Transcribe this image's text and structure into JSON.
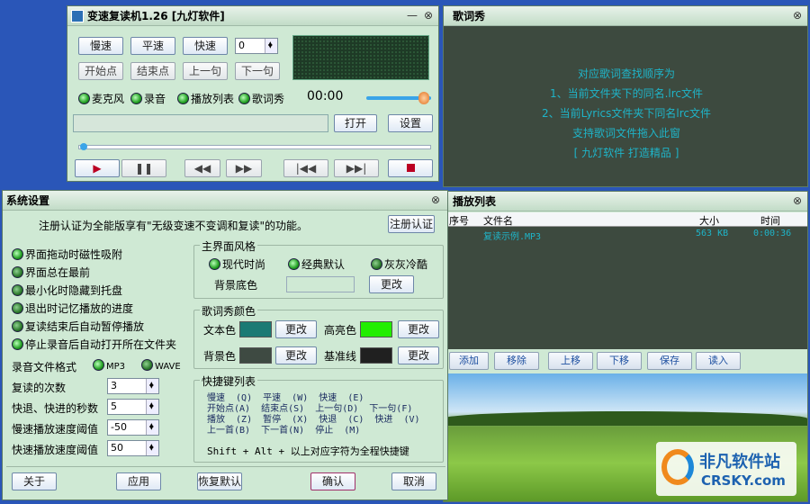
{
  "player": {
    "title": "变速复读机1.26 [九灯软件]",
    "close": "⊗",
    "buttons": [
      "慢速",
      "平速",
      "快速"
    ],
    "speed_value": "0",
    "buttons2": [
      "开始点",
      "结束点",
      "上一句",
      "下一句"
    ],
    "toggles": [
      "麦克风",
      "录音",
      "播放列表",
      "歌词秀"
    ],
    "time": "00:00",
    "open": "打开",
    "settings": "设置"
  },
  "lyric": {
    "title": "歌词秀",
    "close": "⊗",
    "lines": [
      "对应歌词查找顺序为",
      "1、当前文件夹下的同名.lrc文件",
      "2、当前Lyrics文件夹下同名lrc文件",
      "支持歌词文件拖入此窗",
      "[ 九灯软件 打造精品 ]"
    ]
  },
  "settings": {
    "title": "系统设置",
    "close": "⊗",
    "notice": "注册认证为全能版享有\"无级变速不变调和复读\"的功能。",
    "register": "注册认证",
    "options": [
      "界面拖动时磁性吸附",
      "界面总在最前",
      "最小化时隐藏到托盘",
      "退出时记忆播放的进度",
      "复读结束后自动暂停播放",
      "停止录音后自动打开所在文件夹"
    ],
    "record_format_label": "录音文件格式",
    "mp3": "MP3",
    "wave": "WAVE",
    "repeat_label": "复读的次数",
    "repeat_value": "3",
    "skip_label": "快退、快进的秒数",
    "skip_value": "5",
    "slow_label": "慢速播放速度阈值",
    "slow_value": "-50",
    "fast_label": "快速播放速度阈值",
    "fast_value": "50",
    "style_group": "主界面风格",
    "styles": [
      "现代时尚",
      "经典默认",
      "灰灰冷酷"
    ],
    "bg_label": "背景底色",
    "change": "更改",
    "lyric_group": "歌词秀颜色",
    "text_color": "文本色",
    "highlight": "高亮色",
    "bg_color": "背景色",
    "baseline": "基准线",
    "hotkey_group": "快捷键列表",
    "hotkeys": [
      "慢速  (Q)  平速  (W)  快速  (E)",
      "开始点(A)  结束点(S)  上一句(D)  下一句(F)",
      "播放  (Z)  暂停  (X)  快退  (C)  快进  (V)",
      "上一首(B)  下一首(N)  停止  (M)"
    ],
    "hotkey_note": "Shift + Alt + 以上对应字符为全程快捷键",
    "footer": [
      "关于",
      "应用",
      "恢复默认",
      "确认",
      "取消"
    ],
    "colors": {
      "text": "#1b7a74",
      "highlight": "#22ee00",
      "bg": "#3e4a42",
      "baseline": "#202020"
    }
  },
  "playlist": {
    "title": "播放列表",
    "close": "⊗",
    "columns": [
      "序号",
      "文件名",
      "大小",
      "时间"
    ],
    "rows": [
      {
        "name": "复读示例.MP3",
        "size": "563 KB",
        "time": "0:00:36"
      }
    ],
    "buttons": [
      "添加",
      "移除",
      "上移",
      "下移",
      "保存",
      "读入"
    ]
  },
  "watermark": {
    "site": "非凡软件站",
    "domain": "CRSKY.com"
  }
}
